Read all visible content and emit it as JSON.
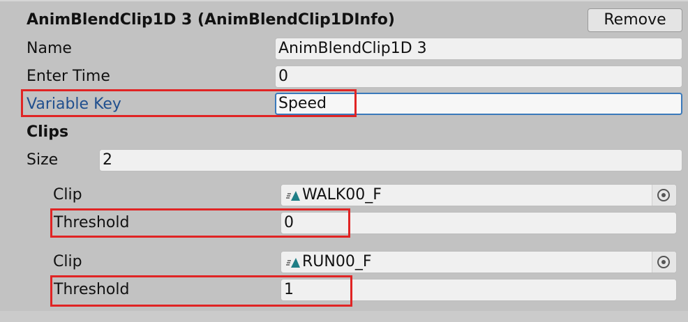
{
  "component": {
    "title": "AnimBlendClip1D 3 (AnimBlendClip1DInfo)",
    "remove_label": "Remove"
  },
  "fields": {
    "name": {
      "label": "Name",
      "value": "AnimBlendClip1D 3"
    },
    "enter_time": {
      "label": "Enter Time",
      "value": "0"
    },
    "variable_key": {
      "label": "Variable Key",
      "value": "Speed"
    }
  },
  "clips": {
    "header": "Clips",
    "size_label": "Size",
    "size_value": "2",
    "items": [
      {
        "clip_label": "Clip",
        "clip_name": "WALK00_F",
        "threshold_label": "Threshold",
        "threshold_value": "0"
      },
      {
        "clip_label": "Clip",
        "clip_name": "RUN00_F",
        "threshold_label": "Threshold",
        "threshold_value": "1"
      }
    ]
  },
  "colors": {
    "highlight": "#e02424",
    "focused_label": "#204f8e",
    "focus_border": "#3a79bb"
  },
  "icons": {
    "clip": "animation-clip-icon",
    "picker": "object-picker-icon"
  }
}
